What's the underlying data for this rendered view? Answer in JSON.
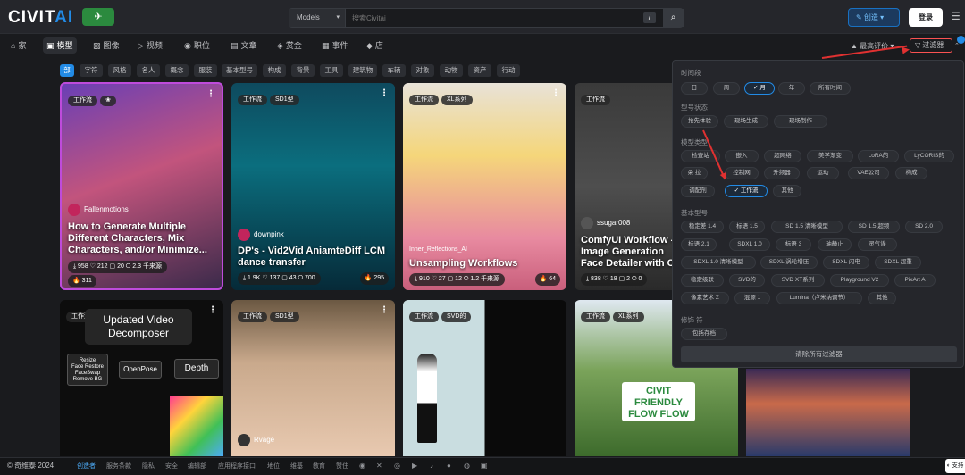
{
  "header": {
    "logo_prefix": "CIVIT",
    "logo_suffix": "AI",
    "logo_badge": "✈",
    "search_type": "Models",
    "search_placeholder": "搜索Civitai",
    "search_shortcut": "/",
    "search_icon": "⌕",
    "create_label": "✎ 创造 ▾",
    "login_label": "登录",
    "menu_icon": "☰"
  },
  "nav": {
    "items": [
      {
        "icon": "⌂",
        "label": "家"
      },
      {
        "icon": "▣",
        "label": "模型"
      },
      {
        "icon": "▨",
        "label": "图像"
      },
      {
        "icon": "▷",
        "label": "视频"
      },
      {
        "icon": "◉",
        "label": "职位"
      },
      {
        "icon": "▤",
        "label": "文章"
      },
      {
        "icon": "◈",
        "label": "赏金"
      },
      {
        "icon": "▦",
        "label": "事件"
      },
      {
        "icon": "◆",
        "label": "店"
      }
    ],
    "sort_label": "▲ 最高评价 ▾",
    "filter_label": "▽ 过滤器",
    "collapse_icon": "⌃"
  },
  "tags": [
    "部",
    "字符",
    "风格",
    "名人",
    "概念",
    "服装",
    "基本型号",
    "构成",
    "背景",
    "工具",
    "建筑物",
    "车辆",
    "对象",
    "动物",
    "资产",
    "行动"
  ],
  "cards": [
    {
      "badges": [
        "工作流",
        "❀"
      ],
      "user": "Fallenmotions",
      "title": "How to Generate Multiple Different Characters, Mix Characters, and/or Minimize...",
      "stats": "⤓ 958  ♡ 212  ▢ 20  ⭘ 2.3 千来源",
      "tip": "311"
    },
    {
      "badges": [
        "工作流",
        "SD1型"
      ],
      "user": "downpink",
      "title": "DP's - Vid2Vid AniamteDiff LCM dance transfer",
      "stats": "⤓ 1.9K  ♡ 137  ▢ 43  ⭘ 700",
      "tip": "295"
    },
    {
      "badges": [
        "工作流",
        "XL系列"
      ],
      "user": "Inner_Reflections_AI",
      "title": "Unsampling Workflows",
      "stats": "⤓ 910  ♡ 27  ▢ 12  ⭘ 1.2 千来源",
      "tip": "64"
    },
    {
      "badges": [
        "工作流"
      ],
      "user": "ssugar008",
      "title": "ComfyUI Workflow - Image Generation Face Detailer with C",
      "stats": "⤓ 838  ♡ 18  ▢ 2  ⭘ 0",
      "tip": ""
    },
    {
      "badges": [
        "工作流"
      ],
      "user": "",
      "title": "Updated Video Decomposer",
      "stats": "",
      "tip": ""
    },
    {
      "badges": [
        "工作流",
        "SD1型"
      ],
      "user": "Rvage",
      "title": "",
      "stats": "",
      "tip": ""
    },
    {
      "badges": [
        "工作流",
        "SVD的"
      ],
      "user": "",
      "title": "",
      "stats": "",
      "tip": ""
    },
    {
      "badges": [
        "工作流",
        "XL系列"
      ],
      "user": "",
      "title": "",
      "stats": "",
      "tip": ""
    }
  ],
  "decomposer": {
    "box1": "Resize\nFace Restore\nFaceSwap\nRemove BG",
    "box2": "OpenPose",
    "box3": "Depth"
  },
  "sign_text": "CIVIT FRIENDLY FLOW FLOW",
  "filter_panel": {
    "time_title": "时间段",
    "time_options": [
      "日",
      "周",
      "✓ 月",
      "年",
      "所有时间"
    ],
    "status_title": "型号状态",
    "status_options": [
      "抢先体验",
      "现场生成",
      "现场制作"
    ],
    "type_title": "模型类型",
    "type_options": [
      "检查站",
      "嵌入",
      "超网络",
      "美学渐变",
      "LoRA的",
      "LyCORIS的",
      "朵 拉",
      "控制网",
      "升频器",
      "运动",
      "VAE公司",
      "构成",
      "调配剂",
      "✓ 工作流",
      "其他"
    ],
    "base_title": "基本型号",
    "base_options": [
      "稳定差 1.4",
      "标语 1.5",
      "SD 1.5 清晰模型",
      "SD 1.5 超频",
      "SD 2.0",
      "标语 2.1",
      "SDXL 1.0",
      "标语 3",
      "轴静止",
      "灵气诶",
      "SDXL 1.0 清晰模型",
      "SDXL 涡轮增压",
      "SDXL 闪电",
      "SDXL 超重",
      "稳定级联",
      "SVD的",
      "SVD XT系列",
      "Playground V2",
      "PixArt A",
      "像素艺术 Σ",
      "混源 1",
      "Lumina（卢米纳调节）",
      "其他"
    ],
    "modifier_title": "修饰 符",
    "modifier_options": [
      "包括存档"
    ],
    "clear_label": "清除所有过滤器"
  },
  "footer": {
    "brand": "© 奇维泰 2024",
    "links": [
      "创造者",
      "服务条款",
      "隐私",
      "安全",
      "编辑部",
      "应用程序接口",
      "地位",
      "维基",
      "教育",
      "赞住"
    ],
    "icons": [
      "discord-icon",
      "x-icon",
      "instagram-icon",
      "youtube-icon",
      "tiktok-icon",
      "reddit-icon",
      "github-icon",
      "twitch-icon"
    ],
    "support": "◐ 支持"
  }
}
